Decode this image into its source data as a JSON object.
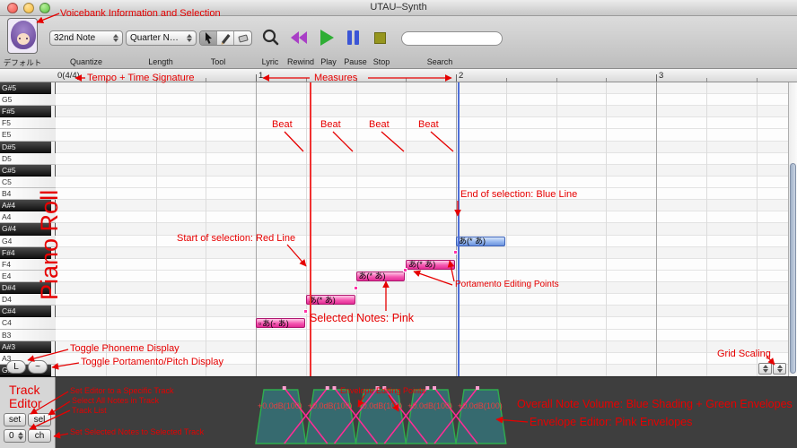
{
  "window": {
    "title": "UTAU–Synth"
  },
  "toolbar": {
    "voicebank_label": "デフォルト",
    "quantize_value": "32nd Note",
    "quantize_label": "Quantize",
    "length_value": "Quarter N…",
    "length_label": "Length",
    "tool_label": "Tool",
    "lyric_label": "Lyric",
    "rewind_label": "Rewind",
    "play_label": "Play",
    "pause_label": "Pause",
    "stop_label": "Stop",
    "search_label": "Search",
    "search_value": ""
  },
  "ruler": {
    "tempo_signature": "0(4/4)",
    "measures": [
      "1",
      "2",
      "3"
    ]
  },
  "piano": {
    "keys": [
      {
        "label": "G#5",
        "type": "black"
      },
      {
        "label": "G5",
        "type": "white"
      },
      {
        "label": "F#5",
        "type": "black"
      },
      {
        "label": "F5",
        "type": "white"
      },
      {
        "label": "E5",
        "type": "white"
      },
      {
        "label": "D#5",
        "type": "black"
      },
      {
        "label": "D5",
        "type": "white"
      },
      {
        "label": "C#5",
        "type": "black"
      },
      {
        "label": "C5",
        "type": "white"
      },
      {
        "label": "B4",
        "type": "white"
      },
      {
        "label": "A#4",
        "type": "black"
      },
      {
        "label": "A4",
        "type": "white"
      },
      {
        "label": "G#4",
        "type": "black"
      },
      {
        "label": "G4",
        "type": "white"
      },
      {
        "label": "F#4",
        "type": "black"
      },
      {
        "label": "F4",
        "type": "white"
      },
      {
        "label": "E4",
        "type": "white"
      },
      {
        "label": "D#4",
        "type": "black"
      },
      {
        "label": "D4",
        "type": "white"
      },
      {
        "label": "C#4",
        "type": "black"
      },
      {
        "label": "C4",
        "type": "white"
      },
      {
        "label": "B3",
        "type": "white"
      },
      {
        "label": "A#3",
        "type": "black"
      },
      {
        "label": "A3",
        "type": "white"
      },
      {
        "label": "G#3",
        "type": "black"
      }
    ]
  },
  "notes": [
    {
      "lyric": "あ(- あ)",
      "prefix": "▫",
      "pitch": "C4",
      "beat": 0,
      "len": 1,
      "state": "selected"
    },
    {
      "lyric": "あ(* あ)",
      "pitch": "D4",
      "beat": 1,
      "len": 1,
      "state": "selected"
    },
    {
      "lyric": "あ(* あ)",
      "pitch": "E4",
      "beat": 2,
      "len": 1,
      "state": "selected"
    },
    {
      "lyric": "あ(* あ)",
      "pitch": "F4",
      "beat": 3,
      "len": 1,
      "state": "selected"
    },
    {
      "lyric": "あ(* あ)",
      "pitch": "G4",
      "beat": 4,
      "len": 1,
      "state": "normal"
    }
  ],
  "envelope": {
    "db_labels": [
      "+0.0dB(100)",
      "+0.0dB(100)",
      "+0.0dB(100)",
      "+0.0dB(100)",
      "+0.0dB(100)"
    ]
  },
  "track_editor": {
    "phoneme_toggle": "L",
    "portamento_toggle": "~",
    "set": "set",
    "select": "sel",
    "track_number": "0",
    "change": "ch"
  },
  "annotations": {
    "voicebank": "Voicebank Information and Selection",
    "tempo": "Tempo + Time Signature",
    "measures": "Measures",
    "beat": "Beat",
    "piano_roll": "Piano Roll",
    "start_selection": "Start of selection: Red Line",
    "end_selection": "End of selection: Blue Line",
    "selected_notes": "Selected Notes: Pink",
    "portamento": "Portamento Editing Points",
    "toggle_phoneme": "Toggle Phoneme Display",
    "toggle_portamento": "Toggle Portamento/Pitch Display",
    "grid_scaling": "Grid Scaling",
    "track_editor": "Track Editor",
    "set_editor": "Set Editor to a Specific Track",
    "select_all": "Select All Notes in Track",
    "track_list": "Track List",
    "set_selected": "Set Selected Notes to Selected Track",
    "envelope_points": "Envelope Editing Points",
    "overall_volume": "Overall Note Volume: Blue Shading + Green Envelopes",
    "envelope_editor": "Envelope Editor: Pink Envelopes"
  },
  "colors": {
    "annotation": "#e60000",
    "selected_note": "#f23fa0",
    "unselected_note": "#6b92dd",
    "selection_start_line": "#f03030",
    "selection_end_line": "#4f6fd8",
    "envelope_fill": "#34767c",
    "envelope_stroke": "#2fae4e",
    "env_pink": "#ff2d96"
  }
}
